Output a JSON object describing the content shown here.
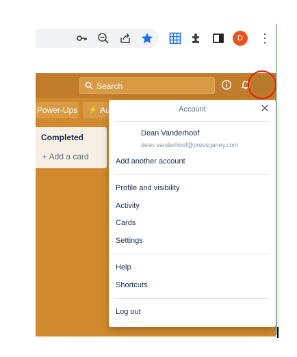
{
  "browser": {
    "profile_initial": "D",
    "accent": "#1a73e8",
    "toolbar_icons": [
      "key-icon",
      "zoom-out-icon",
      "share-icon",
      "star-icon",
      "grid-extension-icon",
      "puzzle-extensions-icon",
      "side-panel-icon"
    ]
  },
  "header": {
    "search_placeholder": "Search",
    "icons": [
      "info-icon",
      "bell-icon"
    ]
  },
  "board": {
    "chips": [
      "Power-Ups",
      "Au"
    ],
    "list_title": "Completed",
    "add_card": "+ Add a card",
    "background_color": "#d0892d"
  },
  "account_menu": {
    "title": "Account",
    "user_name": "Dean Vanderhoof",
    "user_email": "dean.vanderhoof@pressganey.com",
    "add_account": "Add another account",
    "section1": [
      "Profile and visibility",
      "Activity",
      "Cards",
      "Settings"
    ],
    "section2": [
      "Help",
      "Shortcuts"
    ],
    "logout": "Log out"
  },
  "annotation_color": "#e31d1d"
}
